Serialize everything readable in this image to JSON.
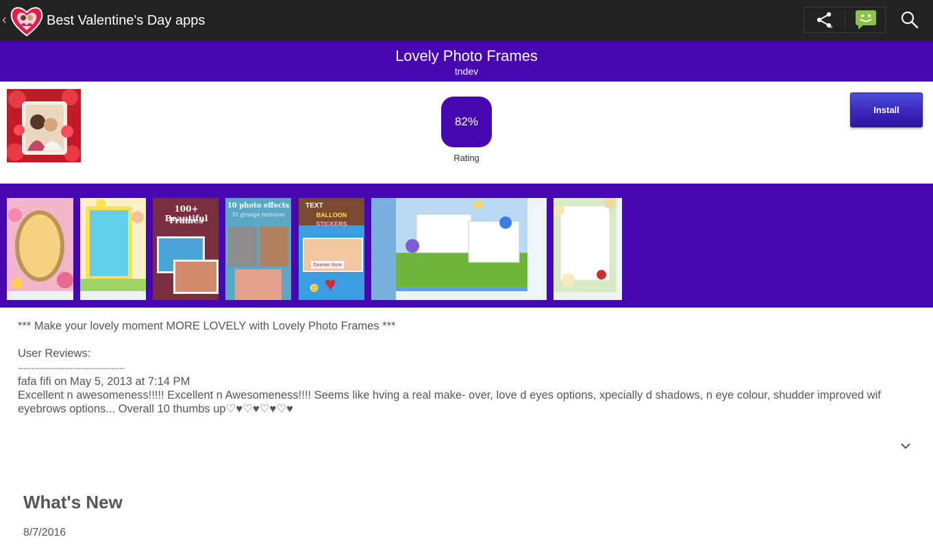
{
  "actionbar": {
    "title": "Best Valentine's Day apps",
    "back_glyph": "‹",
    "icons": [
      "share-icon",
      "chat-icon",
      "search-icon"
    ]
  },
  "app": {
    "name": "Lovely Photo Frames",
    "developer": "tndev",
    "rating_value": "82%",
    "rating_label": "Rating",
    "install_label": "Install"
  },
  "screenshots": {
    "shot_3": [
      "100+ Beautiful",
      "Frames"
    ],
    "shot_4": [
      "10 photo effects",
      "35 grunge textures"
    ],
    "shot_5": [
      "TEXT",
      "BALLOON",
      "STICKERS",
      "forever love"
    ]
  },
  "description": {
    "tagline": "*** Make your lovely moment MORE LOVELY with Lovely Photo Frames ***",
    "reviews_heading": "User Reviews:",
    "separator": "---------------------------------------",
    "review_author": "fafa fifi on May 5, 2013 at 7:14 PM",
    "review_text": "Excellent n awesomeness!!!!! Excellent n Awesomeness!!!! Seems like hving a real make- over, love d eyes options, xpecially d shadows, n eye colour, shudder improved wif eyebrows options... Overall 10 thumbs up♡♥♡♥♡♥♡♥"
  },
  "whats_new": {
    "title": "What's New",
    "date": "8/7/2016"
  },
  "colors": {
    "brand_purple": "#4606b0",
    "actionbar_bg": "#222222",
    "chat_green": "#8bc34a"
  }
}
